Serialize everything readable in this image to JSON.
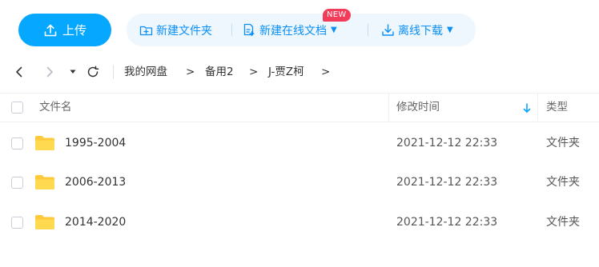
{
  "toolbar": {
    "upload_label": "上传",
    "new_folder_label": "新建文件夹",
    "new_online_doc_label": "新建在线文档",
    "new_badge": "NEW",
    "offline_download_label": "离线下载"
  },
  "nav": {
    "back_icon": "chevron-left-icon",
    "forward_icon": "chevron-right-icon",
    "history_icon": "caret-down-icon",
    "refresh_icon": "refresh-icon",
    "breadcrumb": [
      "我的网盘",
      "备用2",
      "J-贾Z柯"
    ],
    "separator": ">"
  },
  "table": {
    "columns": {
      "name": "文件名",
      "modified": "修改时间",
      "type": "类型"
    },
    "rows": [
      {
        "name": "1995-2004",
        "modified": "2021-12-12 22:33",
        "type": "文件夹"
      },
      {
        "name": "2006-2013",
        "modified": "2021-12-12 22:33",
        "type": "文件夹"
      },
      {
        "name": "2014-2020",
        "modified": "2021-12-12 22:33",
        "type": "文件夹"
      }
    ]
  },
  "colors": {
    "primary": "#06a7ff",
    "action_text": "#0a8ff5",
    "action_bg": "#eef6fe",
    "badge": "#f23c5a",
    "folder": "#ffc93c"
  }
}
